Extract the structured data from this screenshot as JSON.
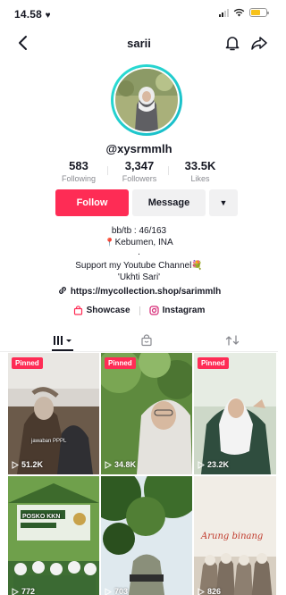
{
  "status": {
    "time": "14.58",
    "heart": "♥"
  },
  "nav": {
    "title": "sarii"
  },
  "profile": {
    "username": "@xysrmmlh",
    "stats": [
      {
        "value": "583",
        "label": "Following"
      },
      {
        "value": "3,347",
        "label": "Followers"
      },
      {
        "value": "33.5K",
        "label": "Likes"
      }
    ]
  },
  "actions": {
    "follow": "Follow",
    "message": "Message",
    "more": "▼"
  },
  "bio": {
    "line1": "bb/tb : 46/163",
    "line2": "Kebumen, INA",
    "line3": ".",
    "line4": "Support my Youtube Channel💐",
    "line5": "'Ukhti Sari'",
    "link": "https://mycollection.shop/sarimmlh"
  },
  "sublinks": {
    "showcase": "Showcase",
    "instagram": "Instagram"
  },
  "videos": [
    {
      "pinned": "Pinned",
      "views": "51.2K",
      "caption": "jawaban PPPL"
    },
    {
      "pinned": "Pinned",
      "views": "34.8K"
    },
    {
      "pinned": "Pinned",
      "views": "23.2K"
    },
    {
      "views": "772",
      "caption": "POSKO KKN"
    },
    {
      "views": "703"
    },
    {
      "views": "826",
      "caption": "Arung binang"
    }
  ],
  "colors": {
    "accent": "#fe2c55",
    "ring": "#20cdd0",
    "text": "#161823",
    "muted": "#8a8b91"
  }
}
